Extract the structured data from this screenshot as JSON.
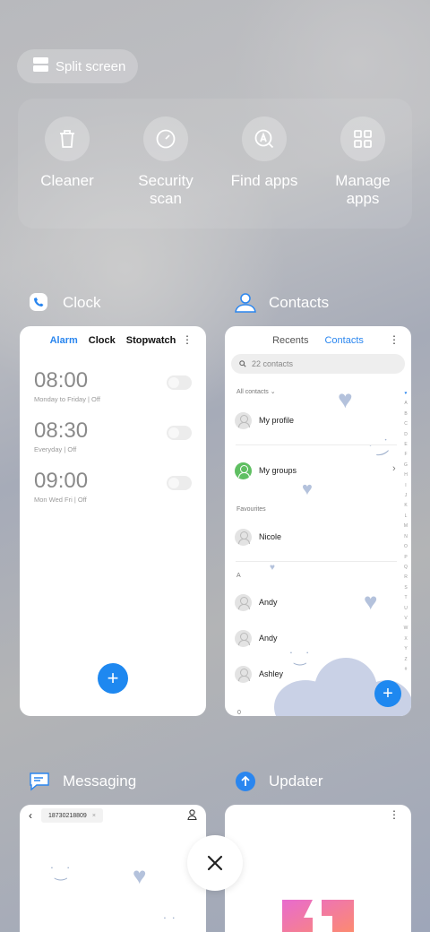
{
  "split_screen": {
    "label": "Split screen"
  },
  "quick_actions": [
    {
      "label": "Cleaner",
      "icon": "trash-icon"
    },
    {
      "label": "Security\nscan",
      "line1": "Security",
      "line2": "scan",
      "icon": "gauge-icon"
    },
    {
      "label": "Find apps",
      "icon": "find-apps-icon"
    },
    {
      "label": "Manage\napps",
      "line1": "Manage",
      "line2": "apps",
      "icon": "grid-icon"
    }
  ],
  "apps": {
    "clock": {
      "name": "Clock",
      "tabs": [
        "Alarm",
        "Clock",
        "Stopwatch"
      ],
      "active_tab": "Alarm",
      "alarms": [
        {
          "time": "08:00",
          "repeat": "Monday to Friday | Off",
          "enabled": false
        },
        {
          "time": "08:30",
          "repeat": "Everyday | Off",
          "enabled": false
        },
        {
          "time": "09:00",
          "repeat": "Mon Wed Fri | Off",
          "enabled": false
        }
      ],
      "fab": "+"
    },
    "contacts": {
      "name": "Contacts",
      "tabs": [
        "Recents",
        "Contacts"
      ],
      "active_tab": "Contacts",
      "search_placeholder": "22 contacts",
      "filter": "All contacts",
      "my_profile": "My profile",
      "my_groups": "My groups",
      "favourites_label": "Favourites",
      "favourites": [
        "Nicole"
      ],
      "section_a": "A",
      "contacts_a": [
        "Andy",
        "Andy",
        "Ashley"
      ],
      "alphabet": [
        "♥",
        "A",
        "B",
        "C",
        "D",
        "E",
        "F",
        "G",
        "H",
        "I",
        "J",
        "K",
        "L",
        "M",
        "N",
        "O",
        "P",
        "Q",
        "R",
        "S",
        "T",
        "U",
        "V",
        "W",
        "X",
        "Y",
        "Z",
        "#"
      ],
      "next_letter": "0",
      "fab": "+"
    },
    "messaging": {
      "name": "Messaging",
      "thread_number": "18730218809"
    },
    "updater": {
      "name": "Updater"
    }
  },
  "colors": {
    "accent": "#2a86ef",
    "fab": "#1e88f0",
    "group_green": "#5fbf62",
    "illustration": "#c9d1e6"
  }
}
